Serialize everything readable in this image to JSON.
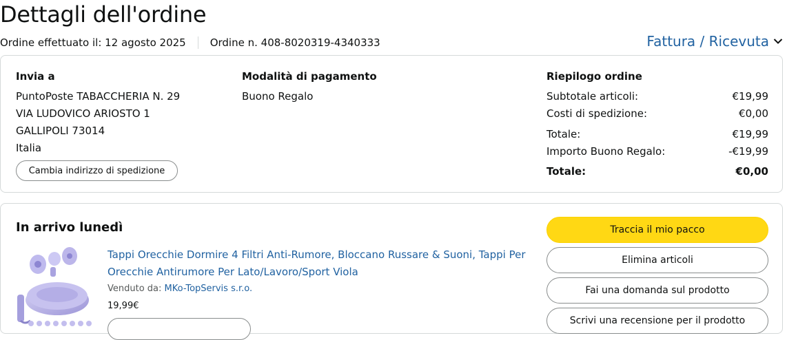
{
  "header": {
    "title": "Dettagli dell'ordine",
    "order_date": "Ordine effettuato il: 12 agosto 2025",
    "order_number": "Ordine n. 408-8020319-4340333",
    "invoice_link": "Fattura / Ricevuta"
  },
  "shipping": {
    "title": "Invia a",
    "lines": [
      "PuntoPoste TABACCHERIA N. 29",
      "VIA LUDOVICO ARIOSTO 1",
      "GALLIPOLI 73014",
      "Italia"
    ],
    "change_button": "Cambia indirizzo di spedizione"
  },
  "payment": {
    "title": "Modalità di pagamento",
    "method": "Buono Regalo"
  },
  "summary": {
    "title": "Riepilogo ordine",
    "rows": [
      {
        "label": "Subtotale articoli:",
        "value": "€19,99"
      },
      {
        "label": "Costi di spedizione:",
        "value": "€0,00"
      },
      {
        "label": "Totale:",
        "value": "€19,99"
      },
      {
        "label": "Importo Buono Regalo:",
        "value": "-€19,99"
      },
      {
        "label": "Totale:",
        "value": "€0,00"
      }
    ]
  },
  "shipment": {
    "status": "In arrivo lunedì",
    "product": {
      "title": "Tappi Orecchie Dormire 4 Filtri Anti-Rumore, Bloccano Russare & Suoni, Tappi Per Orecchie Antirumore Per Lato/Lavoro/Sport Viola",
      "sold_by_label": "Venduto da:",
      "seller": "MKo-TopServis s.r.o.",
      "price": "19,99€"
    },
    "actions": {
      "track": "Traccia il mio pacco",
      "remove": "Elimina articoli",
      "ask": "Fai una domanda sul prodotto",
      "review": "Scrivi una recensione per il prodotto"
    }
  },
  "colors": {
    "link": "#2162a1",
    "primary_button": "#ffd814",
    "border": "#d5d9d9",
    "product_purple": "#b3aee6"
  },
  "icons": {
    "invoice_dropdown": "chevron-down-icon"
  }
}
